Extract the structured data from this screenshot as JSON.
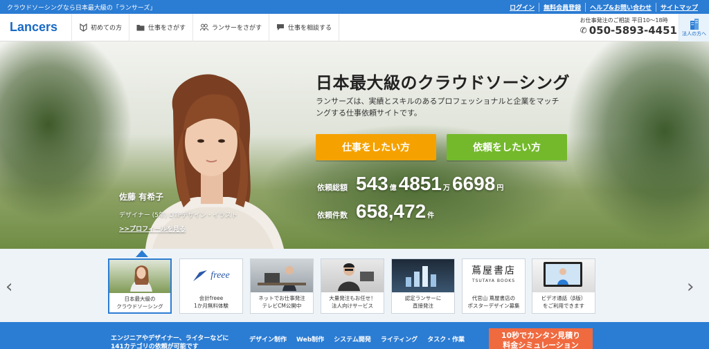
{
  "topbar": {
    "tagline": "クラウドソーシングなら日本最大級の「ランサーズ」",
    "links": [
      "ログイン",
      "無料会員登録",
      "ヘルプ&お問い合わせ",
      "サイトマップ"
    ]
  },
  "header": {
    "logo": "Lancers",
    "nav": [
      {
        "label": "初めての方",
        "icon": "beginner-icon"
      },
      {
        "label": "仕事をさがす",
        "icon": "folder-icon"
      },
      {
        "label": "ランサーをさがす",
        "icon": "people-icon"
      },
      {
        "label": "仕事を相談する",
        "icon": "chat-icon"
      }
    ],
    "contact_note": "お仕事発注のご相談 平日10～18時",
    "phone": "050-5893-4451",
    "corporate_label": "法人の方へ"
  },
  "hero": {
    "title": "日本最大級のクラウドソーシング",
    "description": "ランサーズは、実績とスキルのあるプロフェッショナルと企業をマッチングする仕事依頼サイトです。",
    "button_work": "仕事をしたい方",
    "button_order": "依頼をしたい方",
    "person_name": "佐藤 有希子",
    "person_role": "デザイナー (5年) DTPデザイン・イラスト",
    "person_link": ">>プロフィールを見る",
    "stat_total": {
      "label": "依頼総額",
      "part1": "543",
      "unit1": "億",
      "part2": "4851",
      "unit2": "万",
      "part3": "6698",
      "unit3": "円"
    },
    "stat_count": {
      "label": "依頼件数",
      "value": "658,472",
      "unit": "件"
    }
  },
  "carousel": {
    "prev": "‹",
    "next": "›",
    "cards": [
      {
        "line1": "日本最大級の",
        "line2": "クラウドソーシング"
      },
      {
        "line1": "会計freee",
        "line2": "1か月無料体験",
        "thumb_text": "freee"
      },
      {
        "line1": "ネットでお仕事発注",
        "line2": "テレビCM公開中"
      },
      {
        "line1": "大量発注もお任せ！",
        "line2": "法人向けサービス"
      },
      {
        "line1": "認定ランサーに",
        "line2": "直接発注"
      },
      {
        "line1": "代官山 蔦屋書店の",
        "line2": "ポスターデザイン募集",
        "thumb_text": "蔦屋書店",
        "thumb_sub": "TSUTAYA BOOKS"
      },
      {
        "line1": "ビデオ通話（β版）",
        "line2": "をご利用できます"
      }
    ]
  },
  "bottom": {
    "intro1": "エンジニアやデザイナー、ライターなどに",
    "intro2": "141カテゴリの依頼が可能です",
    "categories": [
      "デザイン制作",
      "Web制作",
      "システム開発",
      "ライティング",
      "タスク・作業"
    ],
    "estimate1": "10秒でカンタン見積り",
    "estimate2": "料金シミュレーション"
  },
  "colors": {
    "primary_blue": "#2b7cd3",
    "orange": "#f5a200",
    "green": "#74b92c",
    "cta_red": "#f06a3f"
  }
}
